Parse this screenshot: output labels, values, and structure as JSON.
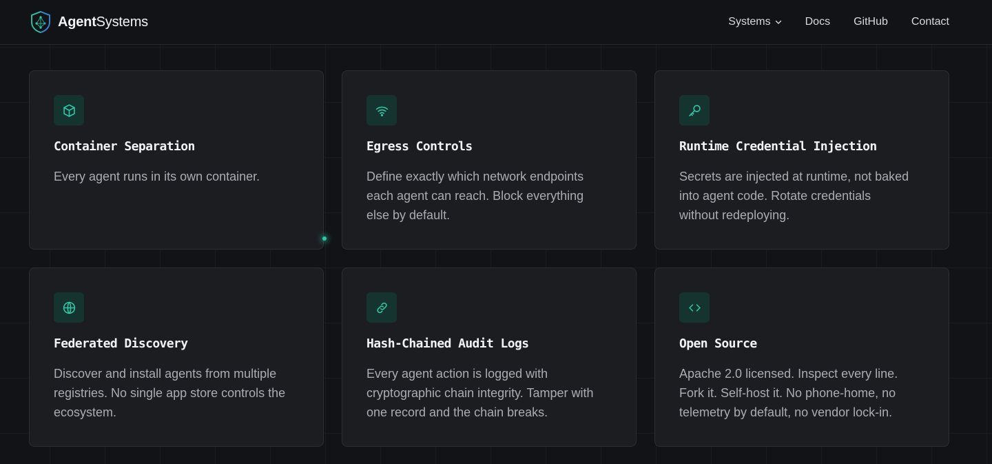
{
  "brand": {
    "bold": "Agent",
    "light": "Systems",
    "logo_icon": "shield-network-logo",
    "accent": "#2fc8a8"
  },
  "nav": {
    "links": [
      {
        "label": "Systems",
        "has_dropdown": true
      },
      {
        "label": "Docs"
      },
      {
        "label": "GitHub"
      },
      {
        "label": "Contact"
      }
    ]
  },
  "features": [
    {
      "icon": "cube-icon",
      "title": "Container Separation",
      "desc": "Every agent runs in its own container."
    },
    {
      "icon": "wifi-icon",
      "title": "Egress Controls",
      "desc": "Define exactly which network endpoints each agent can reach. Block everything else by default."
    },
    {
      "icon": "key-icon",
      "title": "Runtime Credential Injection",
      "desc": "Secrets are injected at runtime, not baked into agent code. Rotate credentials without redeploying."
    },
    {
      "icon": "globe-icon",
      "title": "Federated Discovery",
      "desc": "Discover and install agents from multiple registries. No single app store controls the ecosystem."
    },
    {
      "icon": "link-icon",
      "title": "Hash-Chained Audit Logs",
      "desc": "Every agent action is logged with cryptographic chain integrity. Tamper with one record and the chain breaks."
    },
    {
      "icon": "code-icon",
      "title": "Open Source",
      "desc": "Apache 2.0 licensed. Inspect every line. Fork it. Self-host it. No phone-home, no telemetry by default, no vendor lock-in."
    }
  ],
  "colors": {
    "background": "#121316",
    "card": "#1c1d21",
    "icon_bg": "#153430",
    "icon_fg": "#2fc8a8"
  }
}
